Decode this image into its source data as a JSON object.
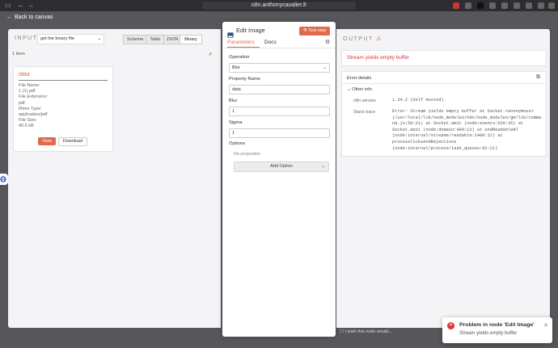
{
  "browser": {
    "url": "n8n.anthonycavalier.fr"
  },
  "header": {
    "back_label": "Back to canvas"
  },
  "input": {
    "title": "INPUT",
    "node_select": "get the binary file",
    "view_tabs": [
      "Schema",
      "Table",
      "JSON",
      "Binary"
    ],
    "item_count": "1 item",
    "card": {
      "title": "data",
      "meta": [
        {
          "k": "File Name:",
          "v": "1 (1).pdf"
        },
        {
          "k": "File Extension:",
          "v": "pdf"
        },
        {
          "k": "Mime Type:",
          "v": "application/pdf"
        },
        {
          "k": "File Size:",
          "v": "40.5 kB"
        }
      ],
      "view_label": "View",
      "download_label": "Download"
    }
  },
  "edit": {
    "title": "Edit Image",
    "test_step_label": "Test step",
    "tabs": [
      "Parameters",
      "Docs"
    ],
    "operation_label": "Operation",
    "operation_value": "Blur",
    "property_name_label": "Property Name",
    "property_name_value": "data",
    "blur_label": "Blur",
    "blur_value": "1",
    "sigma_label": "Sigma",
    "sigma_value": "1",
    "options_label": "Options",
    "no_properties": "No properties",
    "add_option_label": "Add Option"
  },
  "output": {
    "title": "OUTPUT",
    "error_title": "Stream yields empty buffer",
    "error_details_label": "Error details",
    "other_info_label": "Other info",
    "n8n_version_label": "n8n version",
    "n8n_version_value": "1.34.2 (Self Hosted)",
    "stack_trace_label": "Stack trace",
    "stack_trace_lines": [
      "Error: Stream yields empty buffer at Socket.<anonymous>",
      "(/usr/local/lib/node_modules/n8n/node_modules/gm/lib/comma",
      "nd.js:56:21) at Socket.emit (node:events:529:35) at",
      "Socket.emit (node:domain:489:12) at endReadableNT",
      "(node:internal/streams/readable:1400:12) at",
      "processTicksAndRejections",
      "(node:internal/process/task_queues:82:21)"
    ]
  },
  "footer": {
    "hint": "I wish this node would..."
  },
  "toast": {
    "title": "Problem in node 'Edit Image'",
    "message": "Stream yields empty buffer"
  },
  "colors": {
    "accent": "#e06a4f",
    "error": "#d9363e",
    "backdrop": "#57575b"
  }
}
